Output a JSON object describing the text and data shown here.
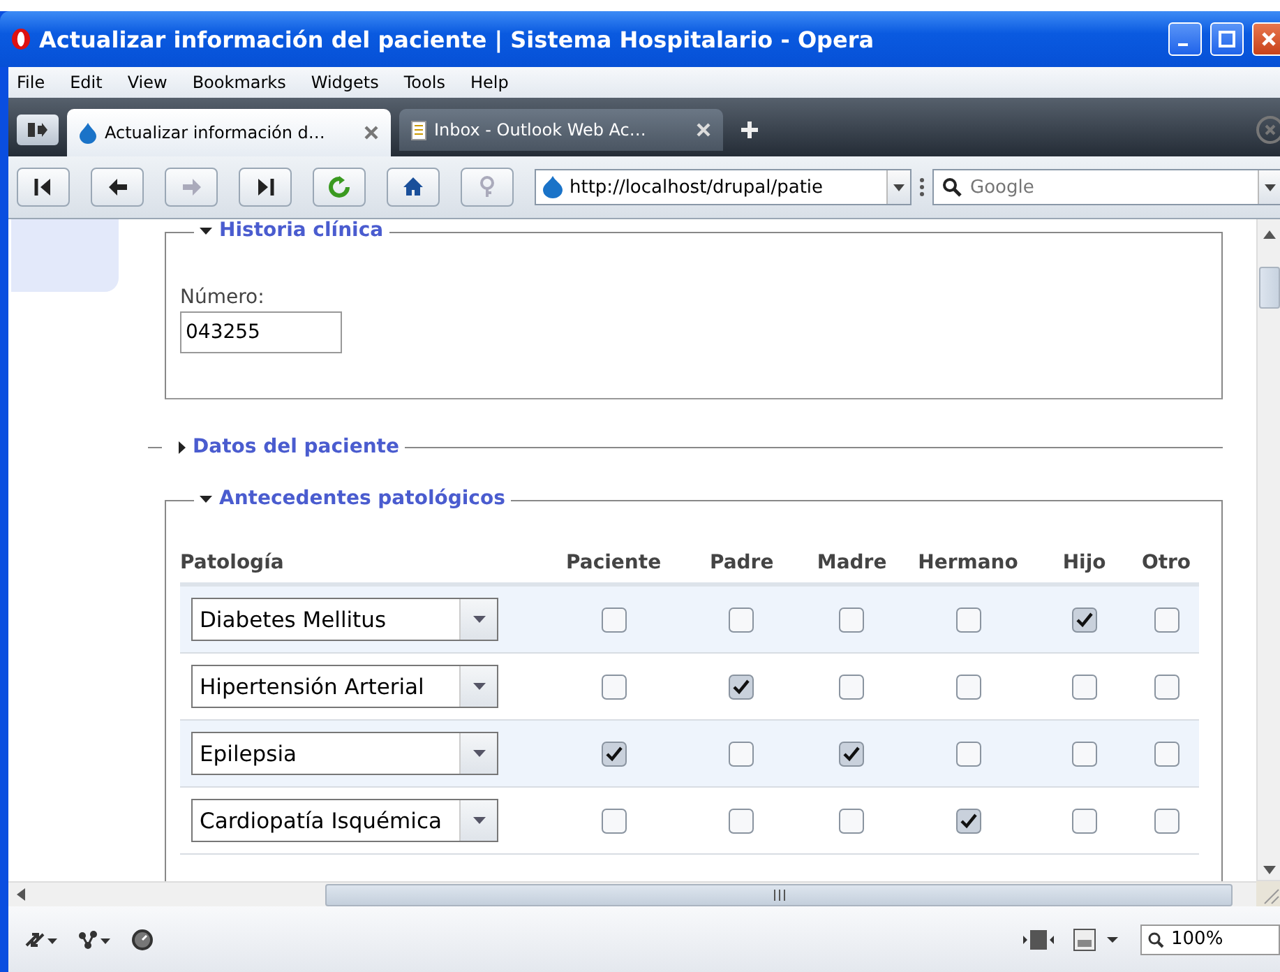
{
  "window": {
    "title": "Actualizar información del paciente | Sistema Hospitalario - Opera"
  },
  "menu": [
    "File",
    "Edit",
    "View",
    "Bookmarks",
    "Widgets",
    "Tools",
    "Help"
  ],
  "tabs": [
    {
      "label": "Actualizar información d…",
      "selected": true
    },
    {
      "label": "Inbox - Outlook Web Ac…",
      "selected": false
    }
  ],
  "address": {
    "value": "http://localhost/drupal/patie"
  },
  "search": {
    "placeholder": "Google"
  },
  "historia": {
    "title": "Historia clínica",
    "expanded": true,
    "field": {
      "label": "Número:",
      "value": "043255"
    }
  },
  "datos": {
    "title": "Datos del paciente",
    "expanded": false
  },
  "antecedentes": {
    "title": "Antecedentes patológicos",
    "expanded": true,
    "columns": [
      "Patología",
      "Paciente",
      "Padre",
      "Madre",
      "Hermano",
      "Hijo",
      "Otro"
    ],
    "rows": [
      {
        "pathology": "Diabetes Mellitus",
        "checks": [
          false,
          false,
          false,
          false,
          true,
          false
        ]
      },
      {
        "pathology": "Hipertensión Arterial",
        "checks": [
          false,
          true,
          false,
          false,
          false,
          false
        ]
      },
      {
        "pathology": "Epilepsia",
        "checks": [
          true,
          false,
          true,
          false,
          false,
          false
        ]
      },
      {
        "pathology": "Cardiopatía Isquémica",
        "checks": [
          false,
          false,
          false,
          true,
          false,
          false
        ]
      }
    ]
  },
  "status_bar": {
    "zoom": "100%"
  }
}
